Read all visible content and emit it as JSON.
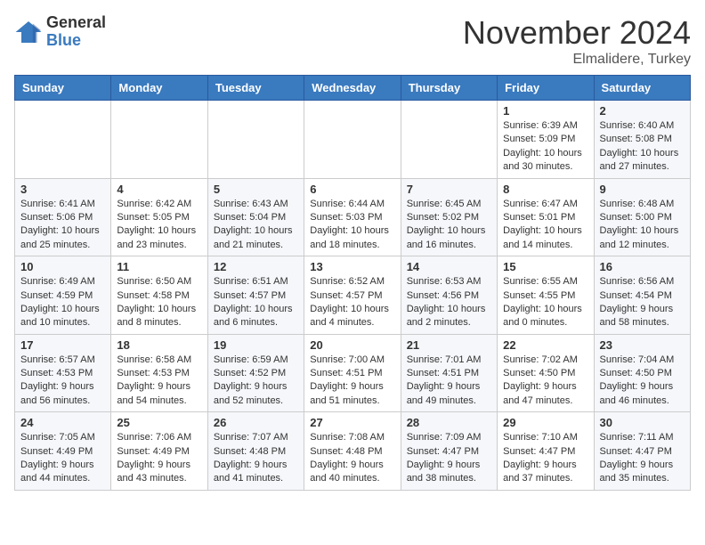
{
  "header": {
    "logo": {
      "general": "General",
      "blue": "Blue"
    },
    "title": "November 2024",
    "location": "Elmalidere, Turkey"
  },
  "weekdays": [
    "Sunday",
    "Monday",
    "Tuesday",
    "Wednesday",
    "Thursday",
    "Friday",
    "Saturday"
  ],
  "weeks": [
    [
      {
        "day": "",
        "info": ""
      },
      {
        "day": "",
        "info": ""
      },
      {
        "day": "",
        "info": ""
      },
      {
        "day": "",
        "info": ""
      },
      {
        "day": "",
        "info": ""
      },
      {
        "day": "1",
        "info": "Sunrise: 6:39 AM\nSunset: 5:09 PM\nDaylight: 10 hours and 30 minutes."
      },
      {
        "day": "2",
        "info": "Sunrise: 6:40 AM\nSunset: 5:08 PM\nDaylight: 10 hours and 27 minutes."
      }
    ],
    [
      {
        "day": "3",
        "info": "Sunrise: 6:41 AM\nSunset: 5:06 PM\nDaylight: 10 hours and 25 minutes."
      },
      {
        "day": "4",
        "info": "Sunrise: 6:42 AM\nSunset: 5:05 PM\nDaylight: 10 hours and 23 minutes."
      },
      {
        "day": "5",
        "info": "Sunrise: 6:43 AM\nSunset: 5:04 PM\nDaylight: 10 hours and 21 minutes."
      },
      {
        "day": "6",
        "info": "Sunrise: 6:44 AM\nSunset: 5:03 PM\nDaylight: 10 hours and 18 minutes."
      },
      {
        "day": "7",
        "info": "Sunrise: 6:45 AM\nSunset: 5:02 PM\nDaylight: 10 hours and 16 minutes."
      },
      {
        "day": "8",
        "info": "Sunrise: 6:47 AM\nSunset: 5:01 PM\nDaylight: 10 hours and 14 minutes."
      },
      {
        "day": "9",
        "info": "Sunrise: 6:48 AM\nSunset: 5:00 PM\nDaylight: 10 hours and 12 minutes."
      }
    ],
    [
      {
        "day": "10",
        "info": "Sunrise: 6:49 AM\nSunset: 4:59 PM\nDaylight: 10 hours and 10 minutes."
      },
      {
        "day": "11",
        "info": "Sunrise: 6:50 AM\nSunset: 4:58 PM\nDaylight: 10 hours and 8 minutes."
      },
      {
        "day": "12",
        "info": "Sunrise: 6:51 AM\nSunset: 4:57 PM\nDaylight: 10 hours and 6 minutes."
      },
      {
        "day": "13",
        "info": "Sunrise: 6:52 AM\nSunset: 4:57 PM\nDaylight: 10 hours and 4 minutes."
      },
      {
        "day": "14",
        "info": "Sunrise: 6:53 AM\nSunset: 4:56 PM\nDaylight: 10 hours and 2 minutes."
      },
      {
        "day": "15",
        "info": "Sunrise: 6:55 AM\nSunset: 4:55 PM\nDaylight: 10 hours and 0 minutes."
      },
      {
        "day": "16",
        "info": "Sunrise: 6:56 AM\nSunset: 4:54 PM\nDaylight: 9 hours and 58 minutes."
      }
    ],
    [
      {
        "day": "17",
        "info": "Sunrise: 6:57 AM\nSunset: 4:53 PM\nDaylight: 9 hours and 56 minutes."
      },
      {
        "day": "18",
        "info": "Sunrise: 6:58 AM\nSunset: 4:53 PM\nDaylight: 9 hours and 54 minutes."
      },
      {
        "day": "19",
        "info": "Sunrise: 6:59 AM\nSunset: 4:52 PM\nDaylight: 9 hours and 52 minutes."
      },
      {
        "day": "20",
        "info": "Sunrise: 7:00 AM\nSunset: 4:51 PM\nDaylight: 9 hours and 51 minutes."
      },
      {
        "day": "21",
        "info": "Sunrise: 7:01 AM\nSunset: 4:51 PM\nDaylight: 9 hours and 49 minutes."
      },
      {
        "day": "22",
        "info": "Sunrise: 7:02 AM\nSunset: 4:50 PM\nDaylight: 9 hours and 47 minutes."
      },
      {
        "day": "23",
        "info": "Sunrise: 7:04 AM\nSunset: 4:50 PM\nDaylight: 9 hours and 46 minutes."
      }
    ],
    [
      {
        "day": "24",
        "info": "Sunrise: 7:05 AM\nSunset: 4:49 PM\nDaylight: 9 hours and 44 minutes."
      },
      {
        "day": "25",
        "info": "Sunrise: 7:06 AM\nSunset: 4:49 PM\nDaylight: 9 hours and 43 minutes."
      },
      {
        "day": "26",
        "info": "Sunrise: 7:07 AM\nSunset: 4:48 PM\nDaylight: 9 hours and 41 minutes."
      },
      {
        "day": "27",
        "info": "Sunrise: 7:08 AM\nSunset: 4:48 PM\nDaylight: 9 hours and 40 minutes."
      },
      {
        "day": "28",
        "info": "Sunrise: 7:09 AM\nSunset: 4:47 PM\nDaylight: 9 hours and 38 minutes."
      },
      {
        "day": "29",
        "info": "Sunrise: 7:10 AM\nSunset: 4:47 PM\nDaylight: 9 hours and 37 minutes."
      },
      {
        "day": "30",
        "info": "Sunrise: 7:11 AM\nSunset: 4:47 PM\nDaylight: 9 hours and 35 minutes."
      }
    ]
  ]
}
